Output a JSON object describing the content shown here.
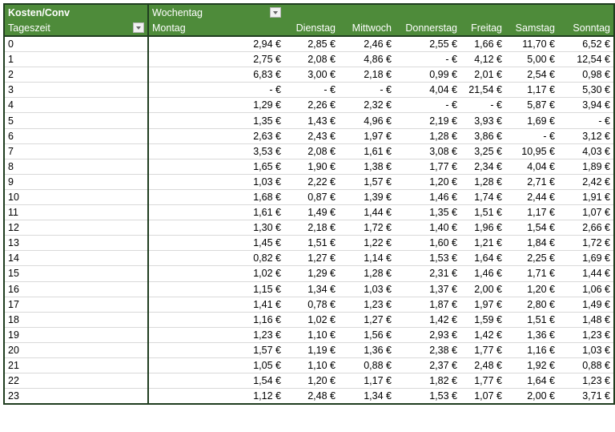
{
  "header": {
    "corner_label": "Kosten/Conv",
    "column_field": "Wochentag",
    "row_field": "Tageszeit",
    "filter_icon": "dropdown-arrow-icon",
    "days": [
      "Montag",
      "Dienstag",
      "Mittwoch",
      "Donnerstag",
      "Freitag",
      "Samstag",
      "Sonntag"
    ]
  },
  "colors": {
    "header_bg": "#4e8b3a",
    "header_text": "#ffffff",
    "border": "#1f3d1f",
    "row_line": "#d9d9d9"
  },
  "rows": [
    {
      "hour": "0",
      "values": [
        "2,94 €",
        "2,85 €",
        "2,46 €",
        "2,55 €",
        "1,66 €",
        "11,70 €",
        "6,52 €"
      ]
    },
    {
      "hour": "1",
      "values": [
        "2,75 €",
        "2,08 €",
        "4,86 €",
        "-   €",
        "4,12 €",
        "5,00 €",
        "12,54 €"
      ]
    },
    {
      "hour": "2",
      "values": [
        "6,83 €",
        "3,00 €",
        "2,18 €",
        "0,99 €",
        "2,01 €",
        "2,54 €",
        "0,98 €"
      ]
    },
    {
      "hour": "3",
      "values": [
        "-   €",
        "-   €",
        "-   €",
        "4,04 €",
        "21,54 €",
        "1,17 €",
        "5,30 €"
      ]
    },
    {
      "hour": "4",
      "values": [
        "1,29 €",
        "2,26 €",
        "2,32 €",
        "-   €",
        "-   €",
        "5,87 €",
        "3,94 €"
      ]
    },
    {
      "hour": "5",
      "values": [
        "1,35 €",
        "1,43 €",
        "4,96 €",
        "2,19 €",
        "3,93 €",
        "1,69 €",
        "-   €"
      ]
    },
    {
      "hour": "6",
      "values": [
        "2,63 €",
        "2,43 €",
        "1,97 €",
        "1,28 €",
        "3,86 €",
        "-   €",
        "3,12 €"
      ]
    },
    {
      "hour": "7",
      "values": [
        "3,53 €",
        "2,08 €",
        "1,61 €",
        "3,08 €",
        "3,25 €",
        "10,95 €",
        "4,03 €"
      ]
    },
    {
      "hour": "8",
      "values": [
        "1,65 €",
        "1,90 €",
        "1,38 €",
        "1,77 €",
        "2,34 €",
        "4,04 €",
        "1,89 €"
      ]
    },
    {
      "hour": "9",
      "values": [
        "1,03 €",
        "2,22 €",
        "1,57 €",
        "1,20 €",
        "1,28 €",
        "2,71 €",
        "2,42 €"
      ]
    },
    {
      "hour": "10",
      "values": [
        "1,68 €",
        "0,87 €",
        "1,39 €",
        "1,46 €",
        "1,74 €",
        "2,44 €",
        "1,91 €"
      ]
    },
    {
      "hour": "11",
      "values": [
        "1,61 €",
        "1,49 €",
        "1,44 €",
        "1,35 €",
        "1,51 €",
        "1,17 €",
        "1,07 €"
      ]
    },
    {
      "hour": "12",
      "values": [
        "1,30 €",
        "2,18 €",
        "1,72 €",
        "1,40 €",
        "1,96 €",
        "1,54 €",
        "2,66 €"
      ]
    },
    {
      "hour": "13",
      "values": [
        "1,45 €",
        "1,51 €",
        "1,22 €",
        "1,60 €",
        "1,21 €",
        "1,84 €",
        "1,72 €"
      ]
    },
    {
      "hour": "14",
      "values": [
        "0,82 €",
        "1,27 €",
        "1,14 €",
        "1,53 €",
        "1,64 €",
        "2,25 €",
        "1,69 €"
      ]
    },
    {
      "hour": "15",
      "values": [
        "1,02 €",
        "1,29 €",
        "1,28 €",
        "2,31 €",
        "1,46 €",
        "1,71 €",
        "1,44 €"
      ]
    },
    {
      "hour": "16",
      "values": [
        "1,15 €",
        "1,34 €",
        "1,03 €",
        "1,37 €",
        "2,00 €",
        "1,20 €",
        "1,06 €"
      ]
    },
    {
      "hour": "17",
      "values": [
        "1,41 €",
        "0,78 €",
        "1,23 €",
        "1,87 €",
        "1,97 €",
        "2,80 €",
        "1,49 €"
      ]
    },
    {
      "hour": "18",
      "values": [
        "1,16 €",
        "1,02 €",
        "1,27 €",
        "1,42 €",
        "1,59 €",
        "1,51 €",
        "1,48 €"
      ]
    },
    {
      "hour": "19",
      "values": [
        "1,23 €",
        "1,10 €",
        "1,56 €",
        "2,93 €",
        "1,42 €",
        "1,36 €",
        "1,23 €"
      ]
    },
    {
      "hour": "20",
      "values": [
        "1,57 €",
        "1,19 €",
        "1,36 €",
        "2,38 €",
        "1,77 €",
        "1,16 €",
        "1,03 €"
      ]
    },
    {
      "hour": "21",
      "values": [
        "1,05 €",
        "1,10 €",
        "0,88 €",
        "2,37 €",
        "2,48 €",
        "1,92 €",
        "0,88 €"
      ]
    },
    {
      "hour": "22",
      "values": [
        "1,54 €",
        "1,20 €",
        "1,17 €",
        "1,82 €",
        "1,77 €",
        "1,64 €",
        "1,23 €"
      ]
    },
    {
      "hour": "23",
      "values": [
        "1,12 €",
        "2,48 €",
        "1,34 €",
        "1,53 €",
        "1,07 €",
        "2,00 €",
        "3,71 €"
      ]
    }
  ]
}
